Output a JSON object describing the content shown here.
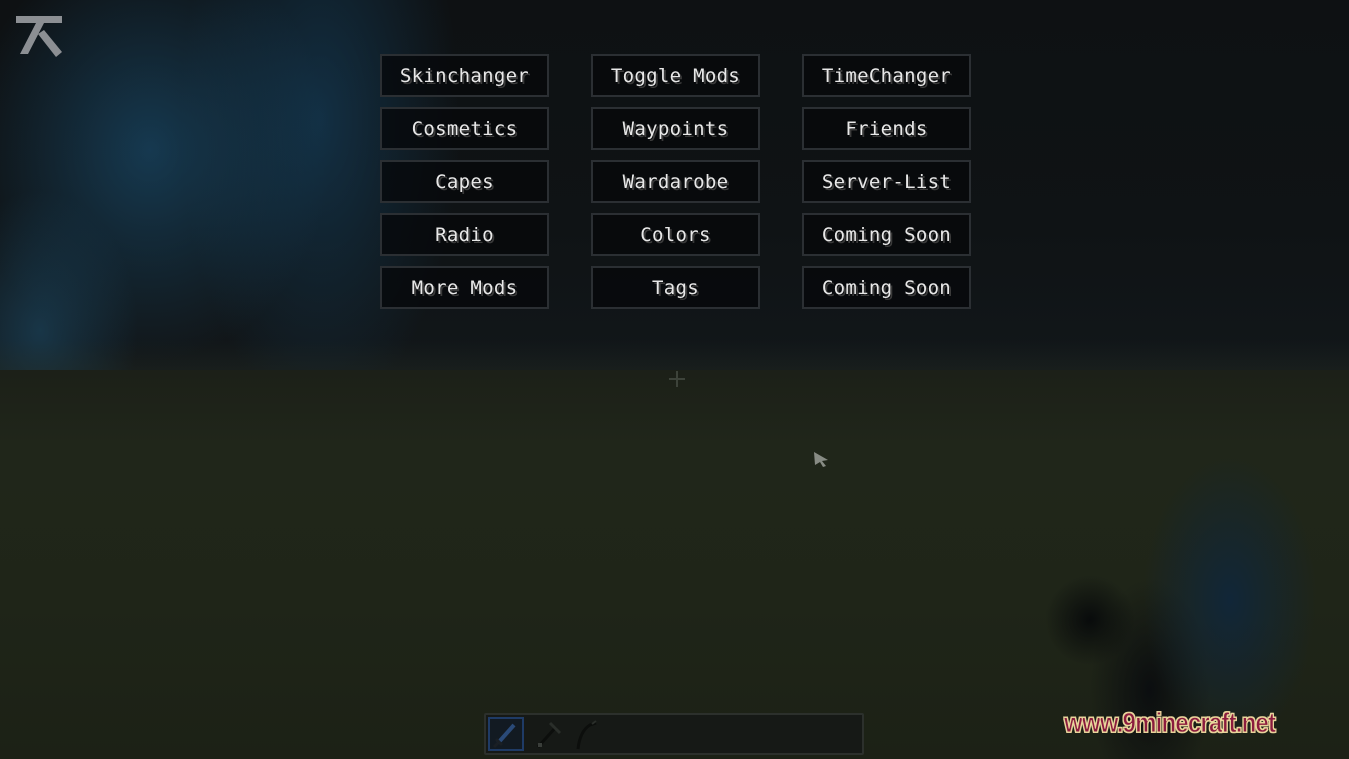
{
  "scene": {
    "description": "Blurred Minecraft world background"
  },
  "client_logo": {
    "icon": "client-logo-icon"
  },
  "menu": {
    "buttons": [
      {
        "label": "Skinchanger"
      },
      {
        "label": "Toggle Mods"
      },
      {
        "label": "TimeChanger"
      },
      {
        "label": "Cosmetics"
      },
      {
        "label": "Waypoints"
      },
      {
        "label": "Friends"
      },
      {
        "label": "Capes"
      },
      {
        "label": "Wardarobe"
      },
      {
        "label": "Server-List"
      },
      {
        "label": "Radio"
      },
      {
        "label": "Colors"
      },
      {
        "label": "Coming Soon"
      },
      {
        "label": "More Mods"
      },
      {
        "label": "Tags"
      },
      {
        "label": "Coming Soon"
      }
    ]
  },
  "hud": {
    "crosshair_icon": "crosshair-icon",
    "cursor_icon": "mouse-cursor-icon",
    "hotbar": {
      "selected_slot": 1,
      "slots": [
        {
          "item": "sword-icon"
        },
        {
          "item": "pickaxe-icon"
        },
        {
          "item": "fishing-rod-icon"
        }
      ]
    }
  },
  "watermark": {
    "text": "www.9minecraft.net"
  },
  "colors": {
    "button_bg": "#06080a",
    "button_border": "#2b2f33",
    "button_text": "#e8e8e8",
    "hotbar_selected": "#1f3b66",
    "watermark_fill": "#8b1b3e",
    "watermark_outline": "#e9d49b"
  }
}
